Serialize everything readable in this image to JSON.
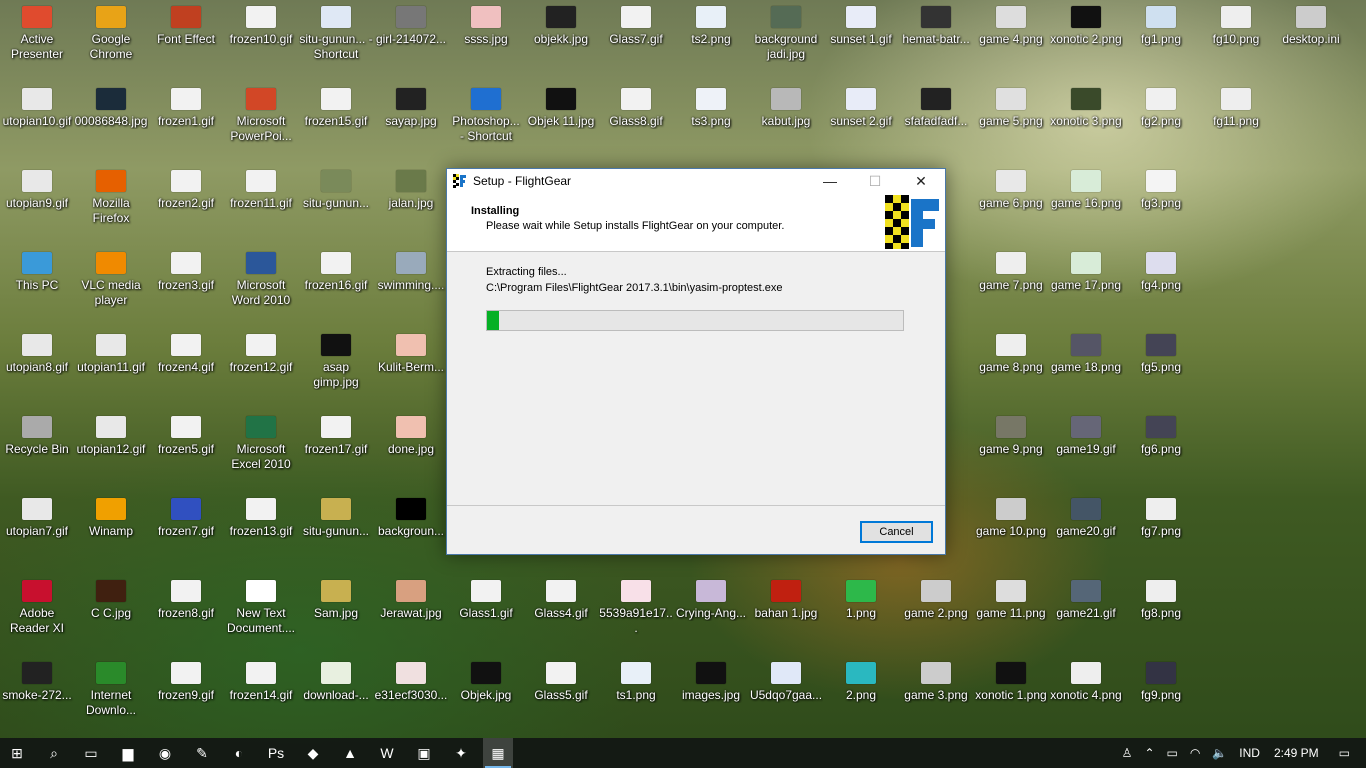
{
  "desktop_icons": [
    {
      "label": "Active Presenter",
      "icon": "red-circle",
      "color": "#e04b2e",
      "col": 0,
      "row": 0
    },
    {
      "label": "Google Chrome",
      "icon": "chrome",
      "color": "#e8a317",
      "col": 1,
      "row": 0
    },
    {
      "label": "Font Effect",
      "icon": "app",
      "color": "#c04020",
      "col": 2,
      "row": 0
    },
    {
      "label": "frozen10.gif",
      "icon": "gif",
      "color": "#f2f2f2",
      "col": 3,
      "row": 0
    },
    {
      "label": "situ-gunun... - Shortcut",
      "icon": "image",
      "color": "#dfe8f5",
      "col": 4,
      "row": 0
    },
    {
      "label": "girl-214072...",
      "icon": "image",
      "color": "#777",
      "col": 5,
      "row": 0
    },
    {
      "label": "ssss.jpg",
      "icon": "image",
      "color": "#f0c0c0",
      "col": 6,
      "row": 0
    },
    {
      "label": "objekk.jpg",
      "icon": "image",
      "color": "#222",
      "col": 7,
      "row": 0
    },
    {
      "label": "Glass7.gif",
      "icon": "gif",
      "color": "#f2f2f2",
      "col": 8,
      "row": 0
    },
    {
      "label": "ts2.png",
      "icon": "image",
      "color": "#e8f0f8",
      "col": 9,
      "row": 0
    },
    {
      "label": "background jadi.jpg",
      "icon": "image",
      "color": "#556b55",
      "col": 10,
      "row": 0
    },
    {
      "label": "sunset 1.gif",
      "icon": "gif",
      "color": "#e8ecf8",
      "col": 11,
      "row": 0
    },
    {
      "label": "hemat-batr...",
      "icon": "image",
      "color": "#333",
      "col": 12,
      "row": 0
    },
    {
      "label": "game 4.png",
      "icon": "image",
      "color": "#ddd",
      "col": 13,
      "row": 0
    },
    {
      "label": "xonotic 2.png",
      "icon": "image",
      "color": "#111",
      "col": 14,
      "row": 0
    },
    {
      "label": "fg1.png",
      "icon": "image",
      "color": "#cfe0f0",
      "col": 15,
      "row": 0
    },
    {
      "label": "fg10.png",
      "icon": "image",
      "color": "#eee",
      "col": 16,
      "row": 0
    },
    {
      "label": "desktop.ini",
      "icon": "file",
      "color": "#ccc",
      "col": 17,
      "row": 0
    },
    {
      "label": "utopian10.gif",
      "icon": "gif",
      "color": "#e8e8e8",
      "col": 0,
      "row": 1
    },
    {
      "label": "00086848.jpg",
      "icon": "image",
      "color": "#1b2c3a",
      "col": 1,
      "row": 1
    },
    {
      "label": "frozen1.gif",
      "icon": "gif",
      "color": "#f2f2f2",
      "col": 2,
      "row": 1
    },
    {
      "label": "Microsoft PowerPoi...",
      "icon": "ppt",
      "color": "#d24726",
      "col": 3,
      "row": 1
    },
    {
      "label": "frozen15.gif",
      "icon": "gif",
      "color": "#f2f2f2",
      "col": 4,
      "row": 1
    },
    {
      "label": "sayap.jpg",
      "icon": "image",
      "color": "#222",
      "col": 5,
      "row": 1
    },
    {
      "label": "Photoshop... - Shortcut",
      "icon": "ps",
      "color": "#1f6fd1",
      "col": 6,
      "row": 1
    },
    {
      "label": "Objek 11.jpg",
      "icon": "image",
      "color": "#111",
      "col": 7,
      "row": 1
    },
    {
      "label": "Glass8.gif",
      "icon": "gif",
      "color": "#f2f2f2",
      "col": 8,
      "row": 1
    },
    {
      "label": "ts3.png",
      "icon": "image",
      "color": "#eef2f8",
      "col": 9,
      "row": 1
    },
    {
      "label": "kabut.jpg",
      "icon": "image",
      "color": "#b8b8b8",
      "col": 10,
      "row": 1
    },
    {
      "label": "sunset 2.gif",
      "icon": "gif",
      "color": "#e8ecf8",
      "col": 11,
      "row": 1
    },
    {
      "label": "sfafadfadf...",
      "icon": "image",
      "color": "#222",
      "col": 12,
      "row": 1
    },
    {
      "label": "game 5.png",
      "icon": "image",
      "color": "#e0e0e0",
      "col": 13,
      "row": 1
    },
    {
      "label": "xonotic 3.png",
      "icon": "image",
      "color": "#3a4a2a",
      "col": 14,
      "row": 1
    },
    {
      "label": "fg2.png",
      "icon": "image",
      "color": "#f0f0f0",
      "col": 15,
      "row": 1
    },
    {
      "label": "fg11.png",
      "icon": "image",
      "color": "#eee",
      "col": 16,
      "row": 1
    },
    {
      "label": "utopian9.gif",
      "icon": "gif",
      "color": "#e8e8e8",
      "col": 0,
      "row": 2
    },
    {
      "label": "Mozilla Firefox",
      "icon": "firefox",
      "color": "#e66000",
      "col": 1,
      "row": 2
    },
    {
      "label": "frozen2.gif",
      "icon": "gif",
      "color": "#f2f2f2",
      "col": 2,
      "row": 2
    },
    {
      "label": "frozen11.gif",
      "icon": "gif",
      "color": "#f2f2f2",
      "col": 3,
      "row": 2
    },
    {
      "label": "situ-gunun...",
      "icon": "image",
      "color": "#7a8a5a",
      "col": 4,
      "row": 2
    },
    {
      "label": "jalan.jpg",
      "icon": "image",
      "color": "#6a7a4a",
      "col": 5,
      "row": 2
    },
    {
      "label": "game 6.png",
      "icon": "image",
      "color": "#e8e8e8",
      "col": 13,
      "row": 2
    },
    {
      "label": "game 16.png",
      "icon": "image",
      "color": "#d8ecd8",
      "col": 14,
      "row": 2
    },
    {
      "label": "fg3.png",
      "icon": "image",
      "color": "#f4f4f4",
      "col": 15,
      "row": 2
    },
    {
      "label": "This PC",
      "icon": "pc",
      "color": "#3a9ad9",
      "col": 0,
      "row": 3
    },
    {
      "label": "VLC media player",
      "icon": "vlc",
      "color": "#f08a00",
      "col": 1,
      "row": 3
    },
    {
      "label": "frozen3.gif",
      "icon": "gif",
      "color": "#f2f2f2",
      "col": 2,
      "row": 3
    },
    {
      "label": "Microsoft Word 2010",
      "icon": "word",
      "color": "#2b579a",
      "col": 3,
      "row": 3
    },
    {
      "label": "frozen16.gif",
      "icon": "gif",
      "color": "#f2f2f2",
      "col": 4,
      "row": 3
    },
    {
      "label": "swimming....",
      "icon": "image",
      "color": "#9ab",
      "col": 5,
      "row": 3
    },
    {
      "label": "game 7.png",
      "icon": "image",
      "color": "#eee",
      "col": 13,
      "row": 3
    },
    {
      "label": "game 17.png",
      "icon": "image",
      "color": "#d8ecd8",
      "col": 14,
      "row": 3
    },
    {
      "label": "fg4.png",
      "icon": "image",
      "color": "#dde",
      "col": 15,
      "row": 3
    },
    {
      "label": "utopian8.gif",
      "icon": "gif",
      "color": "#e8e8e8",
      "col": 0,
      "row": 4
    },
    {
      "label": "utopian11.gif",
      "icon": "gif",
      "color": "#e8e8e8",
      "col": 1,
      "row": 4
    },
    {
      "label": "frozen4.gif",
      "icon": "gif",
      "color": "#f2f2f2",
      "col": 2,
      "row": 4
    },
    {
      "label": "frozen12.gif",
      "icon": "gif",
      "color": "#f2f2f2",
      "col": 3,
      "row": 4
    },
    {
      "label": "asap gimp.jpg",
      "icon": "image",
      "color": "#111",
      "col": 4,
      "row": 4
    },
    {
      "label": "Kulit-Berm...",
      "icon": "image",
      "color": "#f0c0b0",
      "col": 5,
      "row": 4
    },
    {
      "label": "game 8.png",
      "icon": "image",
      "color": "#eee",
      "col": 13,
      "row": 4
    },
    {
      "label": "game 18.png",
      "icon": "image",
      "color": "#556",
      "col": 14,
      "row": 4
    },
    {
      "label": "fg5.png",
      "icon": "image",
      "color": "#445",
      "col": 15,
      "row": 4
    },
    {
      "label": "Recycle Bin",
      "icon": "bin",
      "color": "#aaa",
      "col": 0,
      "row": 5
    },
    {
      "label": "utopian12.gif",
      "icon": "gif",
      "color": "#e8e8e8",
      "col": 1,
      "row": 5
    },
    {
      "label": "frozen5.gif",
      "icon": "gif",
      "color": "#f2f2f2",
      "col": 2,
      "row": 5
    },
    {
      "label": "Microsoft Excel 2010",
      "icon": "excel",
      "color": "#217346",
      "col": 3,
      "row": 5
    },
    {
      "label": "frozen17.gif",
      "icon": "gif",
      "color": "#f2f2f2",
      "col": 4,
      "row": 5
    },
    {
      "label": "done.jpg",
      "icon": "image",
      "color": "#f0c0b0",
      "col": 5,
      "row": 5
    },
    {
      "label": "game 9.png",
      "icon": "image",
      "color": "#776",
      "col": 13,
      "row": 5
    },
    {
      "label": "game19.gif",
      "icon": "image",
      "color": "#667",
      "col": 14,
      "row": 5
    },
    {
      "label": "fg6.png",
      "icon": "image",
      "color": "#445",
      "col": 15,
      "row": 5
    },
    {
      "label": "utopian7.gif",
      "icon": "gif",
      "color": "#e8e8e8",
      "col": 0,
      "row": 6
    },
    {
      "label": "Winamp",
      "icon": "winamp",
      "color": "#f0a000",
      "col": 1,
      "row": 6
    },
    {
      "label": "frozen7.gif",
      "icon": "gif",
      "color": "#3050c0",
      "col": 2,
      "row": 6
    },
    {
      "label": "frozen13.gif",
      "icon": "gif",
      "color": "#f2f2f2",
      "col": 3,
      "row": 6
    },
    {
      "label": "situ-gunun...",
      "icon": "image",
      "color": "#c8b050",
      "col": 4,
      "row": 6
    },
    {
      "label": "backgroun...",
      "icon": "image",
      "color": "#000",
      "col": 5,
      "row": 6
    },
    {
      "label": "game 10.png",
      "icon": "image",
      "color": "#ccc",
      "col": 13,
      "row": 6
    },
    {
      "label": "game20.gif",
      "icon": "image",
      "color": "#456",
      "col": 14,
      "row": 6
    },
    {
      "label": "fg7.png",
      "icon": "image",
      "color": "#eee",
      "col": 15,
      "row": 6
    },
    {
      "label": "Adobe Reader XI",
      "icon": "pdf",
      "color": "#c8102e",
      "col": 0,
      "row": 7
    },
    {
      "label": "C C.jpg",
      "icon": "image",
      "color": "#402010",
      "col": 1,
      "row": 7
    },
    {
      "label": "frozen8.gif",
      "icon": "gif",
      "color": "#f2f2f2",
      "col": 2,
      "row": 7
    },
    {
      "label": "New Text Document....",
      "icon": "text",
      "color": "#fff",
      "col": 3,
      "row": 7
    },
    {
      "label": "Sam.jpg",
      "icon": "image",
      "color": "#c8b050",
      "col": 4,
      "row": 7
    },
    {
      "label": "Jerawat.jpg",
      "icon": "image",
      "color": "#d8a080",
      "col": 5,
      "row": 7
    },
    {
      "label": "Glass1.gif",
      "icon": "gif",
      "color": "#f2f2f2",
      "col": 6,
      "row": 7
    },
    {
      "label": "Glass4.gif",
      "icon": "gif",
      "color": "#f2f2f2",
      "col": 7,
      "row": 7
    },
    {
      "label": "5539a91e17...",
      "icon": "image",
      "color": "#f8e0e8",
      "col": 8,
      "row": 7
    },
    {
      "label": "Crying-Ang...",
      "icon": "image",
      "color": "#c8b8d8",
      "col": 9,
      "row": 7
    },
    {
      "label": "bahan 1.jpg",
      "icon": "image",
      "color": "#c02010",
      "col": 10,
      "row": 7
    },
    {
      "label": "1.png",
      "icon": "image",
      "color": "#2db84a",
      "col": 11,
      "row": 7
    },
    {
      "label": "game 2.png",
      "icon": "image",
      "color": "#ccc",
      "col": 12,
      "row": 7
    },
    {
      "label": "game 11.png",
      "icon": "image",
      "color": "#ddd",
      "col": 13,
      "row": 7
    },
    {
      "label": "game21.gif",
      "icon": "image",
      "color": "#567",
      "col": 14,
      "row": 7
    },
    {
      "label": "fg8.png",
      "icon": "image",
      "color": "#eee",
      "col": 15,
      "row": 7
    },
    {
      "label": "smoke-272...",
      "icon": "image",
      "color": "#222",
      "col": 0,
      "row": 8
    },
    {
      "label": "Internet Downlo...",
      "icon": "idm",
      "color": "#2a8a2a",
      "col": 1,
      "row": 8
    },
    {
      "label": "frozen9.gif",
      "icon": "gif",
      "color": "#f2f2f2",
      "col": 2,
      "row": 8
    },
    {
      "label": "frozen14.gif",
      "icon": "gif",
      "color": "#f2f2f2",
      "col": 3,
      "row": 8
    },
    {
      "label": "download-...",
      "icon": "image",
      "color": "#e8f0e0",
      "col": 4,
      "row": 8
    },
    {
      "label": "e31ecf3030...",
      "icon": "image",
      "color": "#f0e0e0",
      "col": 5,
      "row": 8
    },
    {
      "label": "Objek.jpg",
      "icon": "image",
      "color": "#111",
      "col": 6,
      "row": 8
    },
    {
      "label": "Glass5.gif",
      "icon": "gif",
      "color": "#f2f2f2",
      "col": 7,
      "row": 8
    },
    {
      "label": "ts1.png",
      "icon": "image",
      "color": "#e8f0f8",
      "col": 8,
      "row": 8
    },
    {
      "label": "images.jpg",
      "icon": "image",
      "color": "#111",
      "col": 9,
      "row": 8
    },
    {
      "label": "U5dqo7gaa...",
      "icon": "image",
      "color": "#e0e8f8",
      "col": 10,
      "row": 8
    },
    {
      "label": "2.png",
      "icon": "image",
      "color": "#2ab8c0",
      "col": 11,
      "row": 8
    },
    {
      "label": "game 3.png",
      "icon": "image",
      "color": "#ccc",
      "col": 12,
      "row": 8
    },
    {
      "label": "xonotic 1.png",
      "icon": "image",
      "color": "#111",
      "col": 13,
      "row": 8
    },
    {
      "label": "xonotic 4.png",
      "icon": "image",
      "color": "#eee",
      "col": 14,
      "row": 8
    },
    {
      "label": "fg9.png",
      "icon": "image",
      "color": "#334",
      "col": 15,
      "row": 8
    }
  ],
  "dialog": {
    "title": "Setup - FlightGear",
    "header_title": "Installing",
    "header_subtitle": "Please wait while Setup installs FlightGear on your computer.",
    "logo_letter": "F",
    "status_text": "Extracting files...",
    "current_file": "C:\\Program Files\\FlightGear 2017.3.1\\bin\\yasim-proptest.exe",
    "progress_fraction": 0.03,
    "progress_color": "#06b025",
    "cancel_label": "Cancel",
    "minimize_glyph": "—",
    "maximize_glyph": "☐",
    "close_glyph": "✕"
  },
  "taskbar": {
    "items": [
      {
        "name": "start-button",
        "glyph": "⊞",
        "active": false
      },
      {
        "name": "search-button",
        "glyph": "⌕",
        "active": false
      },
      {
        "name": "task-view-button",
        "glyph": "▭",
        "active": false
      },
      {
        "name": "file-explorer-taskbar",
        "glyph": "▆",
        "active": false
      },
      {
        "name": "chrome-taskbar",
        "glyph": "◉",
        "active": false
      },
      {
        "name": "paint-taskbar",
        "glyph": "✎",
        "active": false
      },
      {
        "name": "gimp-taskbar",
        "glyph": "◐",
        "active": false
      },
      {
        "name": "photoshop-taskbar",
        "glyph": "Ps",
        "active": false
      },
      {
        "name": "app-taskbar",
        "glyph": "◆",
        "active": false
      },
      {
        "name": "app2-taskbar",
        "glyph": "▲",
        "active": false
      },
      {
        "name": "word-taskbar",
        "glyph": "W",
        "active": false
      },
      {
        "name": "photos-taskbar",
        "glyph": "▣",
        "active": false
      },
      {
        "name": "app3-taskbar",
        "glyph": "✦",
        "active": false
      },
      {
        "name": "flightgear-setup-taskbar",
        "glyph": "▦",
        "active": true
      }
    ],
    "tray": {
      "language": "IND",
      "time": "2:49 PM"
    }
  }
}
